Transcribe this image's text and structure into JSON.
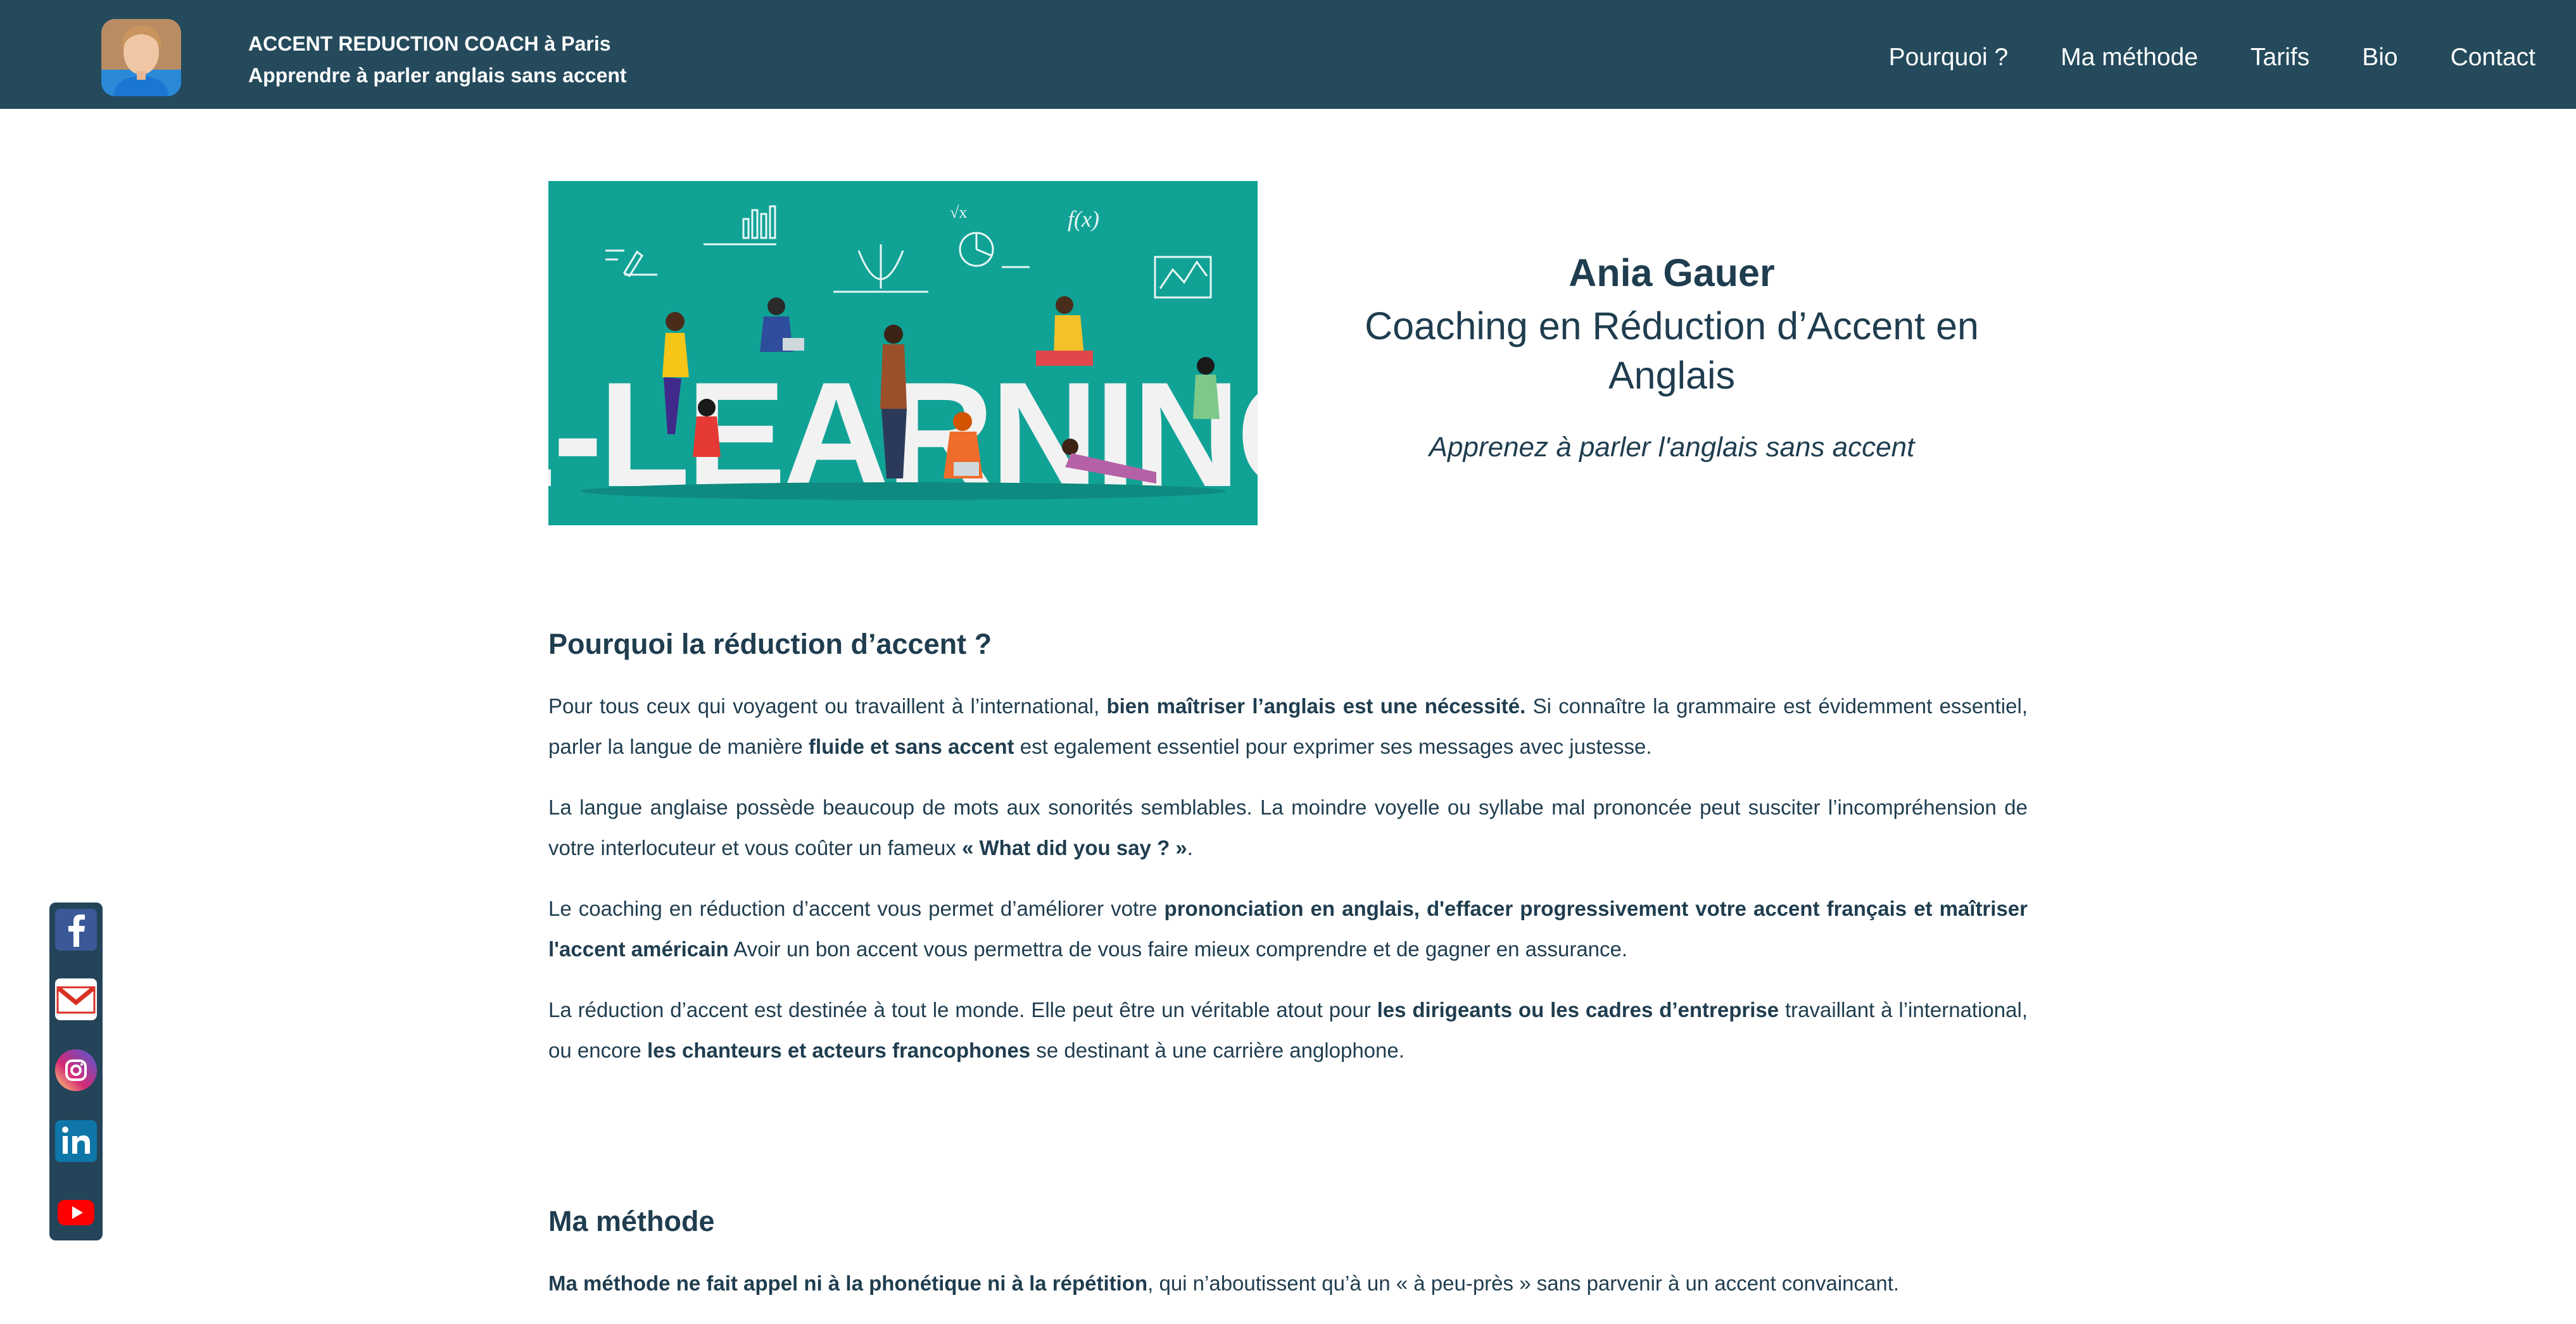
{
  "header": {
    "brand_line1": "ACCENT REDUCTION COACH à Paris",
    "brand_line2": "Apprendre à parler anglais sans accent",
    "nav": [
      "Pourquoi ?",
      "Ma méthode",
      "Tarifs",
      "Bio",
      "Contact"
    ]
  },
  "hero": {
    "image_text": "E-LEARNING",
    "formula": "f(x)",
    "sqrt": "√x",
    "name": "Ania Gauer",
    "role": "Coaching en Réduction d’Accent en Anglais",
    "tagline": "Apprenez à parler l'anglais sans accent"
  },
  "why": {
    "title": "Pourquoi la réduction d’accent ?",
    "p1": [
      "Pour tous ceux qui voyagent ou travaillent à l’international, ",
      "bien maîtriser l’anglais est une nécessité.",
      " Si connaître la grammaire est évidemment essentiel, parler la langue de manière ",
      "fluide et sans accent",
      " est egalement essentiel pour exprimer ses messages avec justesse."
    ],
    "p2": [
      "La langue anglaise possède beaucoup de mots aux sonorités semblables. La moindre voyelle ou syllabe mal prononcée peut susciter l’incompréhension de votre interlocuteur et vous coûter un fameux ",
      "« What did you say ? »",
      "."
    ],
    "p3": [
      "Le coaching en réduction d’accent vous permet d’améliorer votre ",
      "prononciation en anglais, d'effacer progressivement votre accent français et maîtriser l'accent américain",
      " Avoir un bon accent vous permettra de vous faire mieux comprendre et de gagner en assurance."
    ],
    "p4": [
      "La réduction d’accent est destinée à tout le monde. Elle peut être un véritable atout pour ",
      "les dirigeants ou les cadres d’entreprise",
      " travaillant à l’international, ou encore ",
      "les chanteurs et acteurs francophones",
      " se destinant à une carrière anglophone."
    ]
  },
  "method": {
    "title": "Ma méthode",
    "p1": [
      "Ma méthode ne fait appel ni à la phonétique ni à la répétition",
      ", qui n’aboutissent qu’à un « à peu-près » sans parvenir à un accent convaincant."
    ]
  },
  "social": [
    "facebook-icon",
    "gmail-icon",
    "instagram-icon",
    "linkedin-icon",
    "youtube-icon"
  ],
  "colors": {
    "header_bg": "#244a5c",
    "text_dark": "#1f3d4f",
    "hero_teal": "#11a296"
  }
}
